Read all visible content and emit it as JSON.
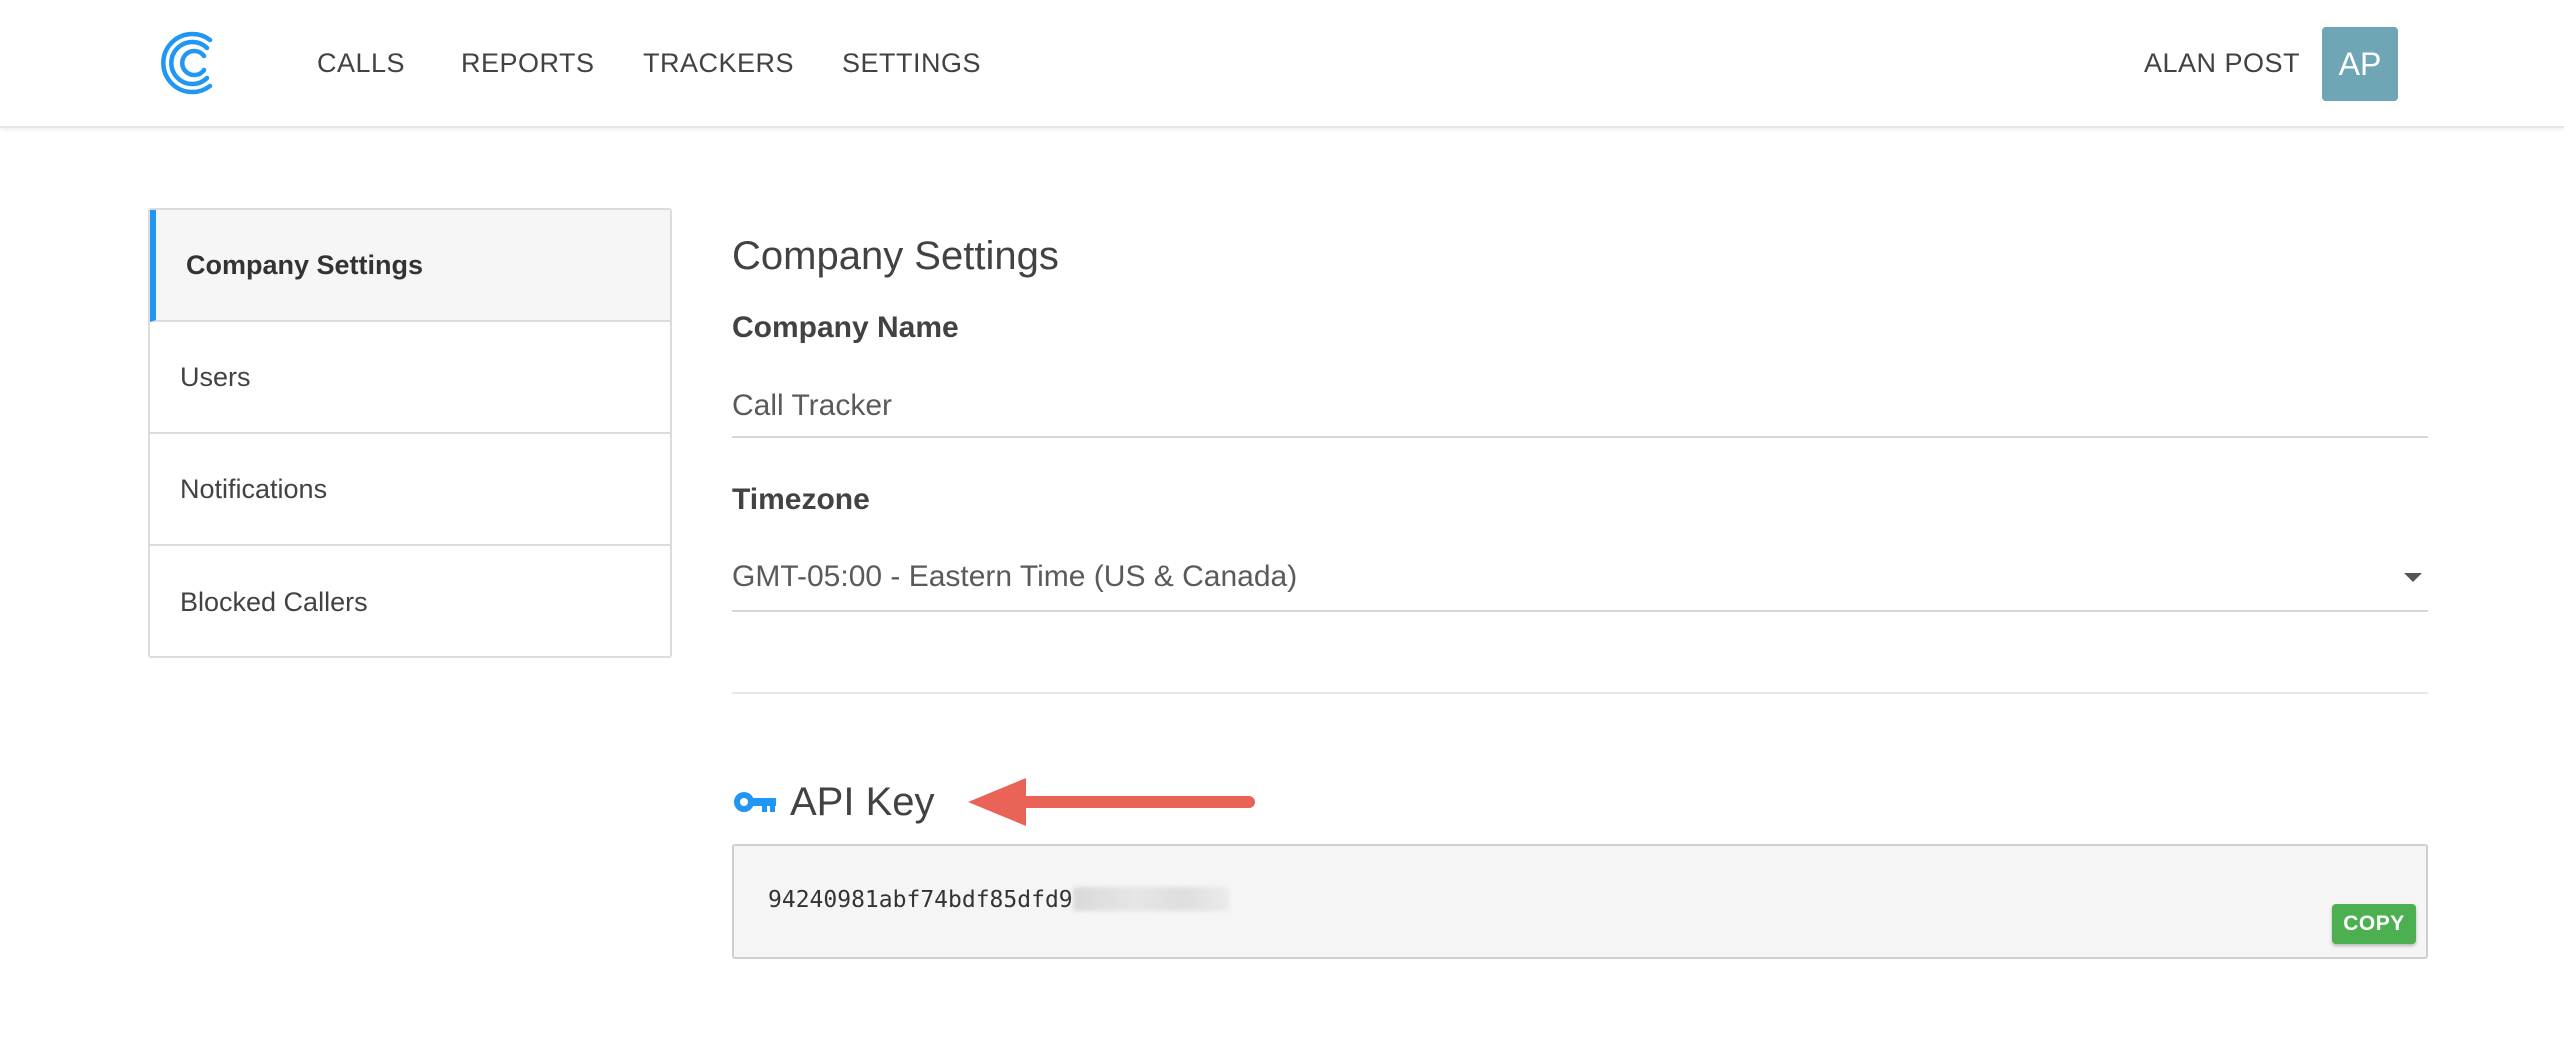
{
  "colors": {
    "accent": "#2196f3",
    "avatar_bg": "#6fa6b6",
    "copy_button": "#4caf50",
    "arrow": "#e96456"
  },
  "header": {
    "logo_icon": "company-logo-icon",
    "nav": {
      "calls": "CALLS",
      "reports": "REPORTS",
      "trackers": "TRACKERS",
      "settings": "SETTINGS"
    },
    "user_name": "ALAN POST",
    "avatar_initials": "AP"
  },
  "sidebar": {
    "items": [
      {
        "label": "Company Settings",
        "active": true
      },
      {
        "label": "Users",
        "active": false
      },
      {
        "label": "Notifications",
        "active": false
      },
      {
        "label": "Blocked Callers",
        "active": false
      }
    ]
  },
  "main": {
    "title": "Company Settings",
    "company_name": {
      "label": "Company Name",
      "value": "Call Tracker"
    },
    "timezone": {
      "label": "Timezone",
      "selected": "GMT-05:00 - Eastern Time (US & Canada)"
    },
    "api_key": {
      "icon": "key-icon",
      "title": "API Key",
      "value_visible": "94240981abf74bdf85dfd9",
      "copy_label": "COPY"
    }
  }
}
